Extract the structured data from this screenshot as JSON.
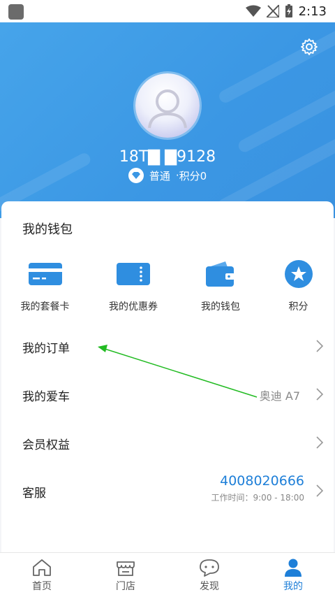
{
  "status_bar": {
    "time": "2:13"
  },
  "profile": {
    "phone": "18T▇ ▇9128",
    "level": "普通",
    "points": "积分0"
  },
  "wallet": {
    "title": "我的钱包",
    "items": [
      {
        "label": "我的套餐卡",
        "icon": "card-icon"
      },
      {
        "label": "我的优惠券",
        "icon": "coupon-icon"
      },
      {
        "label": "我的钱包",
        "icon": "wallet-icon"
      },
      {
        "label": "积分",
        "icon": "star-icon"
      }
    ]
  },
  "menu": {
    "orders": "我的订单",
    "car": {
      "label": "我的爱车",
      "value": "奥迪 A7"
    },
    "member": "会员权益",
    "service": {
      "label": "客服",
      "phone": "4008020666",
      "hours": "工作时间：9:00 - 18:00"
    }
  },
  "tabs": [
    {
      "label": "首页",
      "icon": "home-icon"
    },
    {
      "label": "门店",
      "icon": "store-icon"
    },
    {
      "label": "发现",
      "icon": "chat-bubble-icon"
    },
    {
      "label": "我的",
      "icon": "person-icon",
      "active": true
    }
  ],
  "colors": {
    "header_blue": "#3b97e4",
    "accent_blue": "#1e7fd8",
    "arrow_green": "#22bb22"
  }
}
